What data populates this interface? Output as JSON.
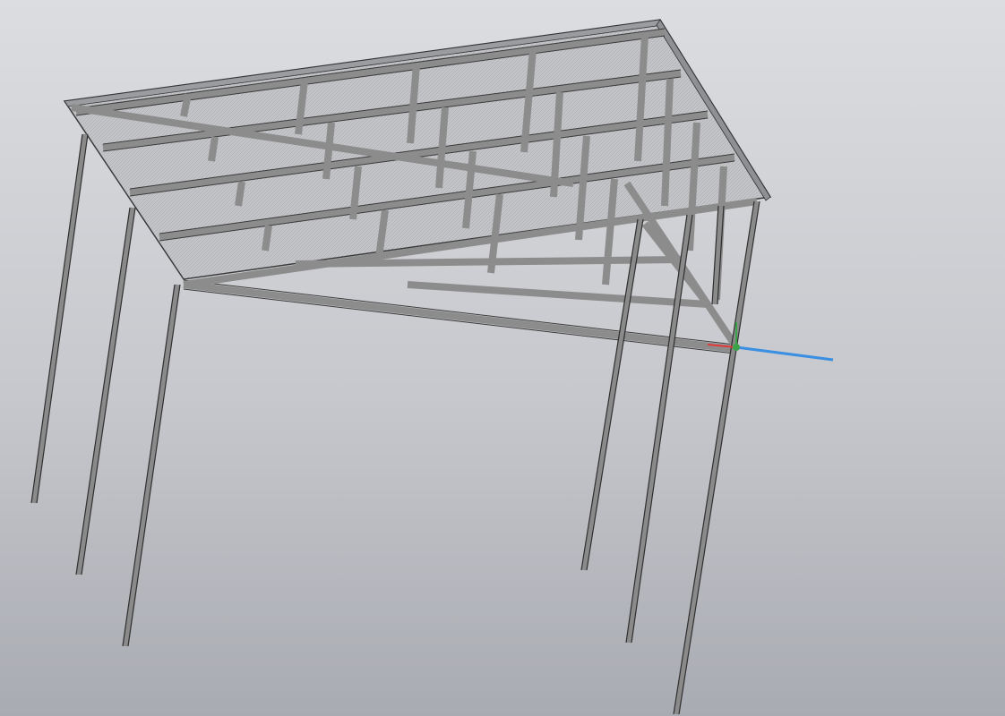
{
  "viewport": {
    "name": "3d-model-viewport",
    "background_top": "#dcdde0",
    "background_bottom": "#a9abb2"
  },
  "model": {
    "description_icon": "steel-canopy-frame",
    "colors": {
      "steel": "#8c8c8c",
      "edges": "#2e2e2e",
      "roof_sheet": "#b8babd"
    }
  },
  "axis_triad": {
    "x_color": "#e23a3a",
    "y_color": "#3aa34a",
    "z_color": "#3a8fe2"
  }
}
